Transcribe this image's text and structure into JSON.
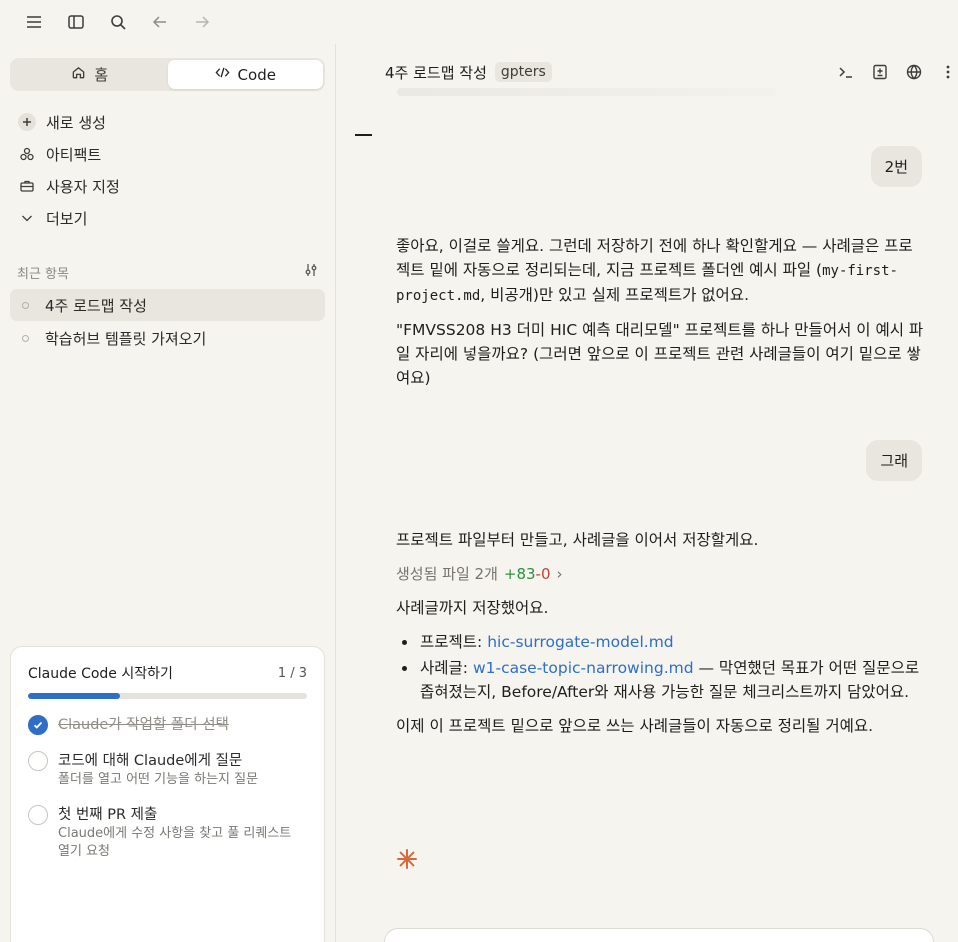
{
  "toolbar": {
    "icons": [
      "menu-icon",
      "sidebar-toggle-icon",
      "search-icon",
      "back-icon",
      "forward-icon"
    ]
  },
  "sidebar": {
    "tabs": [
      {
        "label": "홈",
        "icon": "home-icon",
        "active": false
      },
      {
        "label": "Code",
        "icon": "code-icon",
        "active": true
      }
    ],
    "nav": [
      {
        "label": "새로 생성",
        "icon": "plus-icon"
      },
      {
        "label": "아티팩트",
        "icon": "artifacts-icon"
      },
      {
        "label": "사용자 지정",
        "icon": "briefcase-icon"
      },
      {
        "label": "더보기",
        "icon": "chevron-down-icon"
      }
    ],
    "recent_header": "최근 항목",
    "recent": [
      {
        "label": "4주 로드맵 작성",
        "active": true
      },
      {
        "label": "학습허브 템플릿 가져오기",
        "active": false
      }
    ],
    "onboarding": {
      "title": "Claude Code 시작하기",
      "progress_label": "1 / 3",
      "progress": 0.33,
      "items": [
        {
          "title": "Claude가 작업할 폴더 선택",
          "sub": "",
          "done": true
        },
        {
          "title": "코드에 대해 Claude에게 질문",
          "sub": "폴더를 열고 어떤 기능을 하는지 질문",
          "done": false
        },
        {
          "title": "첫 번째 PR 제출",
          "sub": "Claude에게 수정 사항을 찾고 풀 리퀘스트 열기 요청",
          "done": false
        }
      ]
    }
  },
  "main": {
    "header": {
      "title": "4주 로드맵 작성",
      "tag": "gpters",
      "icons": [
        "terminal-icon",
        "diff-icon",
        "globe-icon",
        "more-icon"
      ]
    },
    "user_msg_1": "2번",
    "assistant_1": {
      "p1_pre": "좋아요, 이걸로 쓸게요. 그런데 저장하기 전에 하나 확인할게요 — 사례글은 프로젝트 밑에 자동으로 정리되는데, 지금 프로젝트 폴더엔 예시 파일 (",
      "p1_code": "my-first-project.md",
      "p1_post": ", 비공개)만 있고 실제 프로젝트가 없어요.",
      "p2": "\"FMVSS208 H3 더미 HIC 예측 대리모델\" 프로젝트를 하나 만들어서 이 예시 파일 자리에 넣을까요? (그러면 앞으로 이 프로젝트 관련 사례글들이 여기 밑으로 쌓여요)"
    },
    "user_msg_2": "그래",
    "assistant_2": {
      "p1": "프로젝트 파일부터 만들고, 사례글을 이어서 저장할게요.",
      "files_label": "생성됨 파일 2개",
      "files_add": "+83",
      "files_del": "-0",
      "files_chevron": "›",
      "p2": "사례글까지 저장했어요.",
      "bullet1_label": "프로젝트: ",
      "bullet1_link": "hic-surrogate-model.md",
      "bullet2_label": "사례글: ",
      "bullet2_link": "w1-case-topic-narrowing.md",
      "bullet2_rest": " — 막연했던 목표가 어떤 질문으로 좁혀졌는지, Before/After와 재사용 가능한 질문 체크리스트까지 담았어요.",
      "p3": "이제 이 프로젝트 밑으로 앞으로 쓰는 사례글들이 자동으로 정리될 거예요."
    },
    "accent_color": "#d9683c",
    "link_color": "#2f6ec6"
  }
}
